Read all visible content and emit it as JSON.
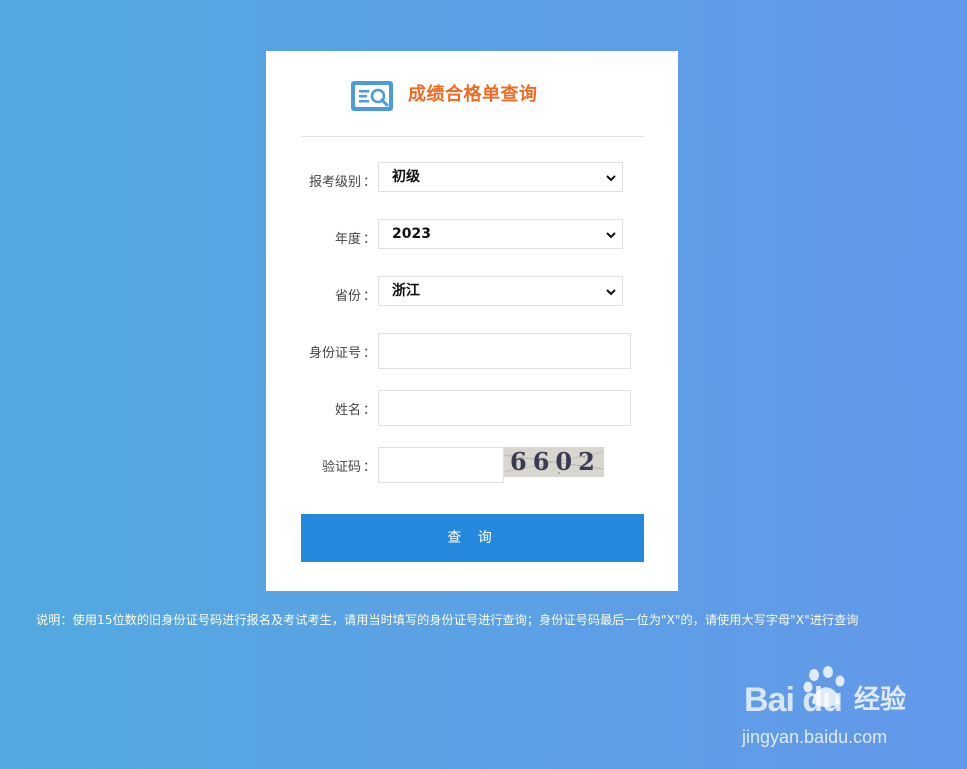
{
  "header": {
    "title": "成绩合格单查询",
    "icon": "search-document-icon",
    "accent_color": "#ef6b22"
  },
  "form": {
    "level": {
      "label": "报考级别",
      "value": "初级"
    },
    "year": {
      "label": "年度",
      "value": "2023"
    },
    "province": {
      "label": "省份",
      "value": "浙江"
    },
    "id_number": {
      "label": "身份证号",
      "value": ""
    },
    "name": {
      "label": "姓名",
      "value": ""
    },
    "captcha": {
      "label": "验证码",
      "value": "",
      "image_text": "6602"
    },
    "colon": "："
  },
  "submit": {
    "label": "查 询",
    "color": "#2489dd"
  },
  "note": "说明：使用15位数的旧身份证号码进行报名及考试考生，请用当时填写的身份证号进行查询；身份证号码最后一位为\"X\"的，请使用大写字母\"X\"进行查询",
  "watermark": {
    "brand": "Bai du",
    "cn": "经验",
    "url": "jingyan.baidu.com"
  }
}
